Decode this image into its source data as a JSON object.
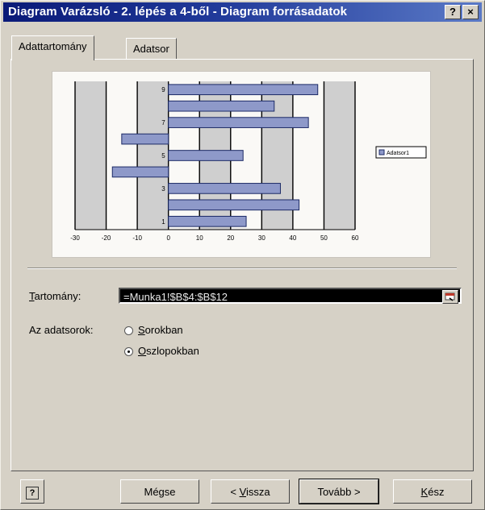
{
  "window": {
    "title": "Diagram Varázsló - 2. lépés a 4-ből - Diagram forrásadatok",
    "help_button": "?",
    "close_button": "×"
  },
  "tabs": [
    {
      "label": "Adattartomány",
      "active": true
    },
    {
      "label": "Adatsor",
      "active": false
    }
  ],
  "chart_data": {
    "type": "bar",
    "orientation": "horizontal",
    "categories": [
      "1",
      "2",
      "3",
      "4",
      "5",
      "6",
      "7",
      "8",
      "9"
    ],
    "category_tick_labels": [
      "1",
      "",
      "3",
      "",
      "5",
      "",
      "7",
      "",
      "9"
    ],
    "series": [
      {
        "name": "Adatsor1",
        "values": [
          25,
          42,
          36,
          -18,
          24,
          -15,
          45,
          34,
          48
        ]
      }
    ],
    "x_ticks": [
      "-30",
      "-20",
      "-10",
      "0",
      "10",
      "20",
      "30",
      "40",
      "50",
      "60"
    ],
    "xlim": [
      -30,
      60
    ],
    "grid": true,
    "legend": "right",
    "bar_color": "#8e99c9"
  },
  "range": {
    "label_underlined": "T",
    "label_rest": "artomány:",
    "value": "=Munka1!$B$4:$B$12"
  },
  "series_in": {
    "label": "Az adatsorok:",
    "rows": {
      "underlined": "S",
      "rest": "orokban",
      "selected": false
    },
    "columns": {
      "underlined": "O",
      "rest": "szlopokban",
      "selected": true
    }
  },
  "buttons": {
    "help": "?",
    "cancel": "Mégse",
    "back_prefix": "< ",
    "back_underlined": "V",
    "back_rest": "issza",
    "next": "Tovább >",
    "finish_underlined": "K",
    "finish_rest": "ész"
  }
}
